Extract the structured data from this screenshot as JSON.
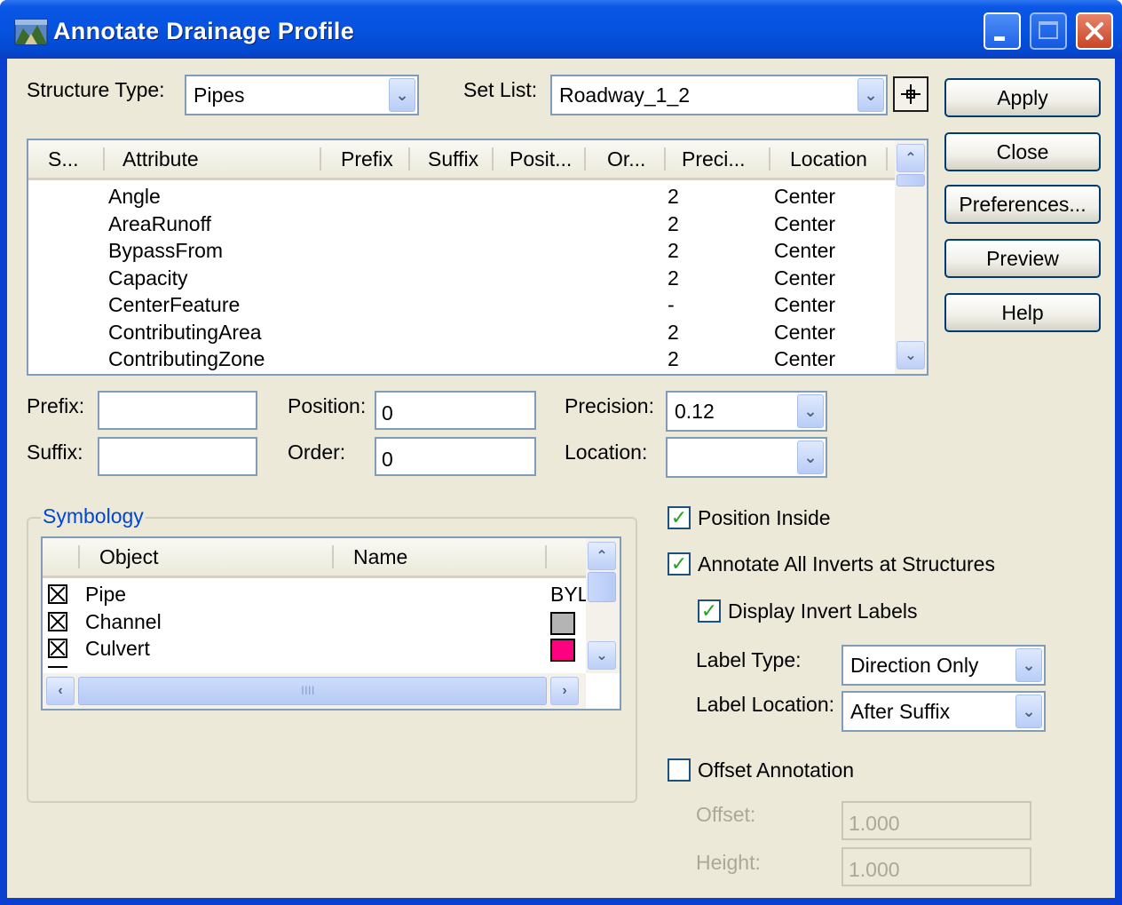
{
  "window": {
    "title": "Annotate Drainage Profile"
  },
  "top": {
    "structure_type_label": "Structure Type:",
    "structure_type_value": "Pipes",
    "set_list_label": "Set List:",
    "set_list_value": "Roadway_1_2"
  },
  "buttons": {
    "apply": "Apply",
    "close": "Close",
    "preferences": "Preferences...",
    "preview": "Preview",
    "help": "Help"
  },
  "attr_table": {
    "columns": [
      "S...",
      "Attribute",
      "Prefix",
      "Suffix",
      "Posit...",
      "Or...",
      "Preci...",
      "Location"
    ],
    "rows": [
      {
        "attribute": "Angle",
        "precision": "2",
        "location": "Center"
      },
      {
        "attribute": "AreaRunoff",
        "precision": "2",
        "location": "Center"
      },
      {
        "attribute": "BypassFrom",
        "precision": "2",
        "location": "Center"
      },
      {
        "attribute": "Capacity",
        "precision": "2",
        "location": "Center"
      },
      {
        "attribute": "CenterFeature",
        "precision": "-",
        "location": "Center"
      },
      {
        "attribute": "ContributingArea",
        "precision": "2",
        "location": "Center"
      },
      {
        "attribute": "ContributingZone",
        "precision": "2",
        "location": "Center"
      }
    ]
  },
  "fields": {
    "prefix_label": "Prefix:",
    "prefix_value": "",
    "suffix_label": "Suffix:",
    "suffix_value": "",
    "position_label": "Position:",
    "position_value": "0",
    "order_label": "Order:",
    "order_value": "0",
    "precision_label": "Precision:",
    "precision_value": "0.12",
    "location_label": "Location:",
    "location_value": ""
  },
  "symbology": {
    "title": "Symbology",
    "columns": [
      "Object",
      "Name"
    ],
    "rows": [
      {
        "object": "Pipe",
        "value_text": "BYL",
        "color": null
      },
      {
        "object": "Channel",
        "value_text": "",
        "color": "#b4b4b4"
      },
      {
        "object": "Culvert",
        "value_text": "",
        "color": "#ff0080"
      }
    ],
    "scroll_grip": "IIII"
  },
  "options": {
    "position_inside": {
      "label": "Position Inside",
      "checked": true
    },
    "annotate_all_inverts": {
      "label": "Annotate All Inverts at Structures",
      "checked": true
    },
    "display_invert_labels": {
      "label": "Display Invert Labels",
      "checked": true
    },
    "label_type_label": "Label Type:",
    "label_type_value": "Direction Only",
    "label_location_label": "Label Location:",
    "label_location_value": "After Suffix",
    "offset_annotation": {
      "label": "Offset Annotation",
      "checked": false
    },
    "offset_label": "Offset:",
    "offset_value": "1.000",
    "height_label": "Height:",
    "height_value": "1.000"
  },
  "colors": {
    "titlebar": "#0553df",
    "dialog_bg": "#ece9d8",
    "group_title": "#0046d5",
    "check": "#21a121"
  }
}
